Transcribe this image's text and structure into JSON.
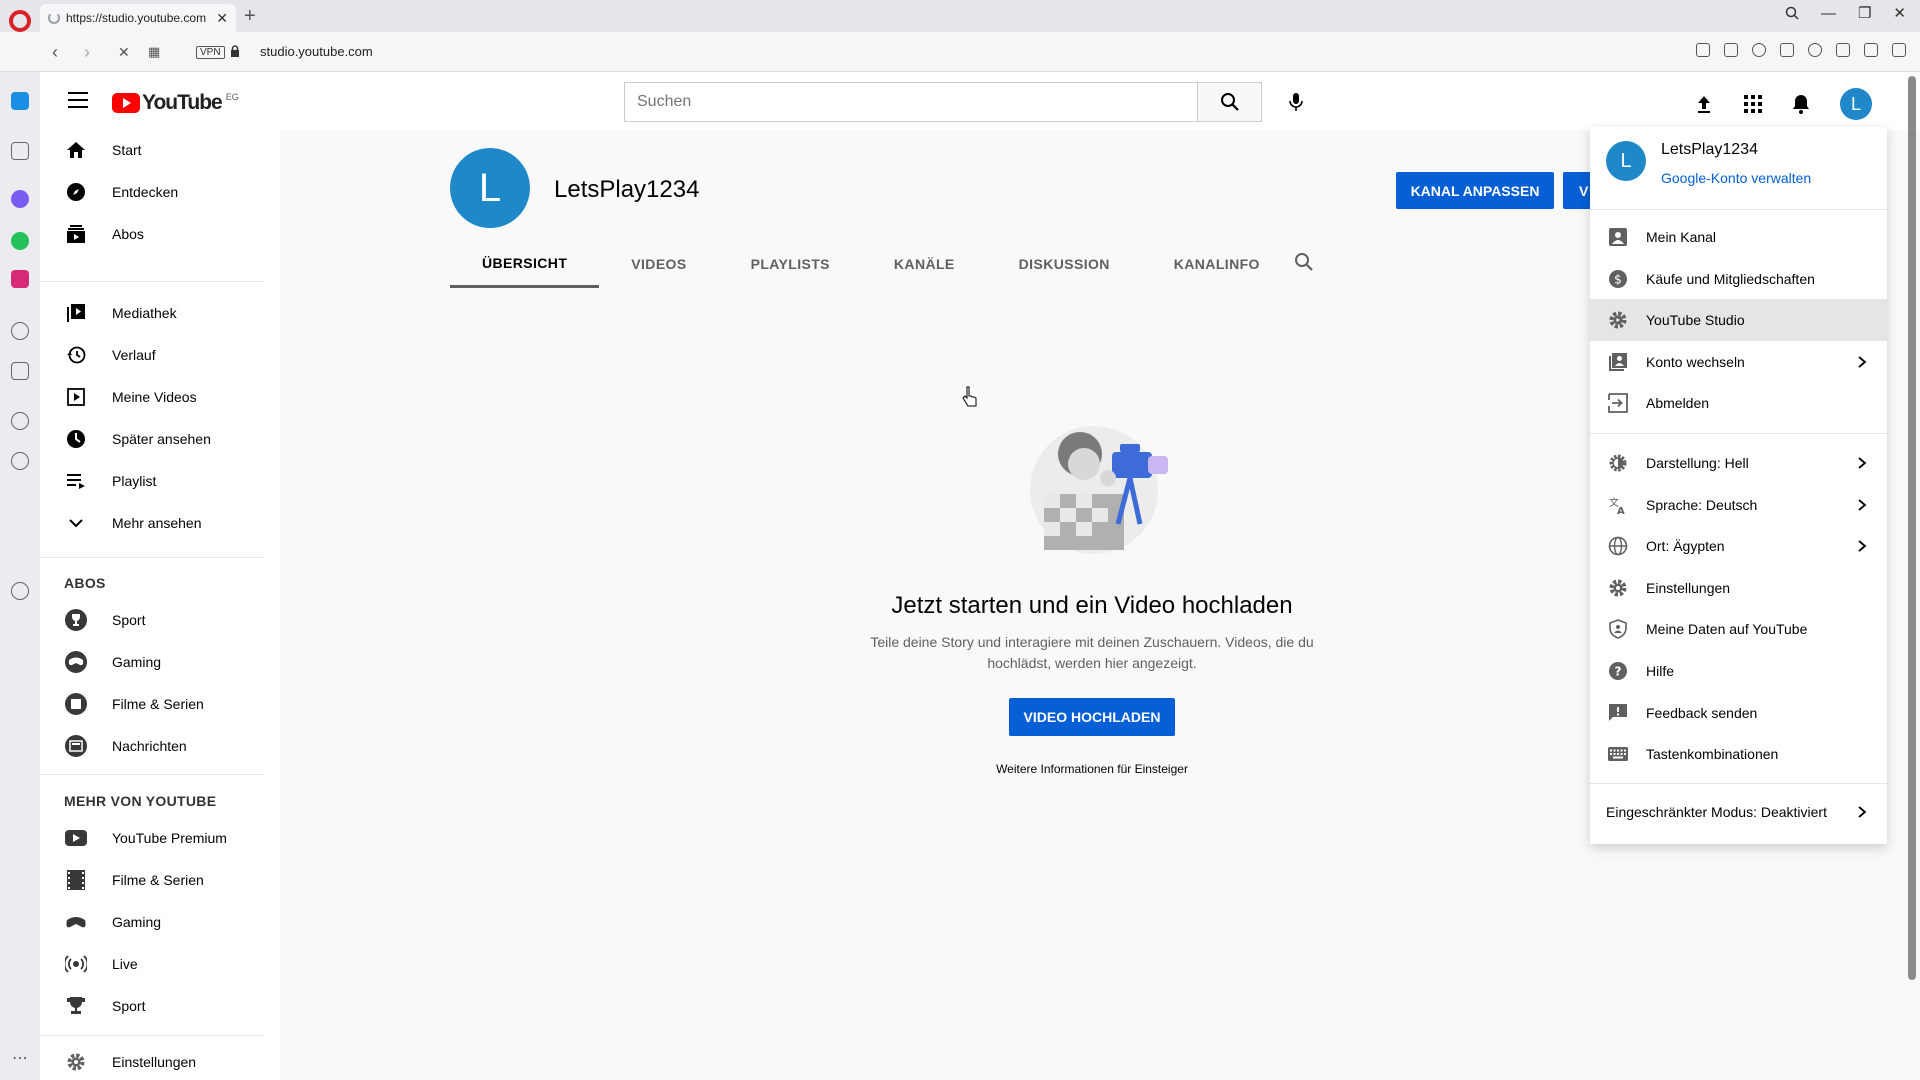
{
  "browser": {
    "tab_title": "https://studio.youtube.com",
    "url": "studio.youtube.com",
    "vpn_label": "VPN",
    "new_tab": "+"
  },
  "header": {
    "logo_text": "YouTube",
    "country_code": "EG",
    "search_placeholder": "Suchen",
    "avatar_letter": "L"
  },
  "sidebar": {
    "main": [
      {
        "label": "Start",
        "icon": "home-icon"
      },
      {
        "label": "Entdecken",
        "icon": "compass-icon"
      },
      {
        "label": "Abos",
        "icon": "subscriptions-icon"
      }
    ],
    "library": [
      {
        "label": "Mediathek",
        "icon": "library-icon"
      },
      {
        "label": "Verlauf",
        "icon": "history-icon"
      },
      {
        "label": "Meine Videos",
        "icon": "my-videos-icon"
      },
      {
        "label": "Später ansehen",
        "icon": "watch-later-icon"
      },
      {
        "label": "Playlist",
        "icon": "playlist-icon"
      },
      {
        "label": "Mehr ansehen",
        "icon": "chevron-down-icon"
      }
    ],
    "abos_heading": "ABOS",
    "abos": [
      {
        "label": "Sport",
        "icon": "sport-channel-icon"
      },
      {
        "label": "Gaming",
        "icon": "gaming-channel-icon"
      },
      {
        "label": "Filme & Serien",
        "icon": "movies-channel-icon"
      },
      {
        "label": "Nachrichten",
        "icon": "news-channel-icon"
      }
    ],
    "more_heading": "MEHR VON YOUTUBE",
    "more": [
      {
        "label": "YouTube Premium",
        "icon": "premium-icon"
      },
      {
        "label": "Filme & Serien",
        "icon": "film-icon"
      },
      {
        "label": "Gaming",
        "icon": "gamepad-icon"
      },
      {
        "label": "Live",
        "icon": "live-icon"
      },
      {
        "label": "Sport",
        "icon": "trophy-icon"
      }
    ],
    "settings": {
      "label": "Einstellungen",
      "icon": "gear-icon"
    }
  },
  "channel": {
    "avatar_letter": "L",
    "name": "LetsPlay1234",
    "customize_button": "KANAL ANPASSEN",
    "manage_button_partial": "V",
    "tabs": [
      "ÜBERSICHT",
      "VIDEOS",
      "PLAYLISTS",
      "KANÄLE",
      "DISKUSSION",
      "KANALINFO"
    ]
  },
  "empty_state": {
    "title": "Jetzt starten und ein Video hochladen",
    "description": "Teile deine Story und interagiere mit deinen Zuschauern. Videos, die du hochlädst, werden hier angezeigt.",
    "upload_button": "VIDEO HOCHLADEN",
    "learn_more": "Weitere Informationen für Einsteiger"
  },
  "account_menu": {
    "avatar_letter": "L",
    "name": "LetsPlay1234",
    "manage_link": "Google-Konto verwalten",
    "group1": [
      {
        "label": "Mein Kanal",
        "icon": "person-icon",
        "chevron": false
      },
      {
        "label": "Käufe und Mitgliedschaften",
        "icon": "dollar-icon",
        "chevron": false
      },
      {
        "label": "YouTube Studio",
        "icon": "studio-gear-icon",
        "chevron": false,
        "hovered": true
      },
      {
        "label": "Konto wechseln",
        "icon": "switch-account-icon",
        "chevron": true
      },
      {
        "label": "Abmelden",
        "icon": "sign-out-icon",
        "chevron": false
      }
    ],
    "group2": [
      {
        "label": "Darstellung: Hell",
        "icon": "appearance-icon",
        "chevron": true
      },
      {
        "label": "Sprache: Deutsch",
        "icon": "translate-icon",
        "chevron": true
      },
      {
        "label": "Ort: Ägypten",
        "icon": "globe-icon",
        "chevron": true
      },
      {
        "label": "Einstellungen",
        "icon": "settings-gear-icon",
        "chevron": false
      },
      {
        "label": "Meine Daten auf YouTube",
        "icon": "shield-icon",
        "chevron": false
      },
      {
        "label": "Hilfe",
        "icon": "help-icon",
        "chevron": false
      },
      {
        "label": "Feedback senden",
        "icon": "feedback-icon",
        "chevron": false
      },
      {
        "label": "Tastenkombinationen",
        "icon": "keyboard-icon",
        "chevron": false
      }
    ],
    "restricted_mode": "Eingeschränkter Modus: Deaktiviert"
  }
}
